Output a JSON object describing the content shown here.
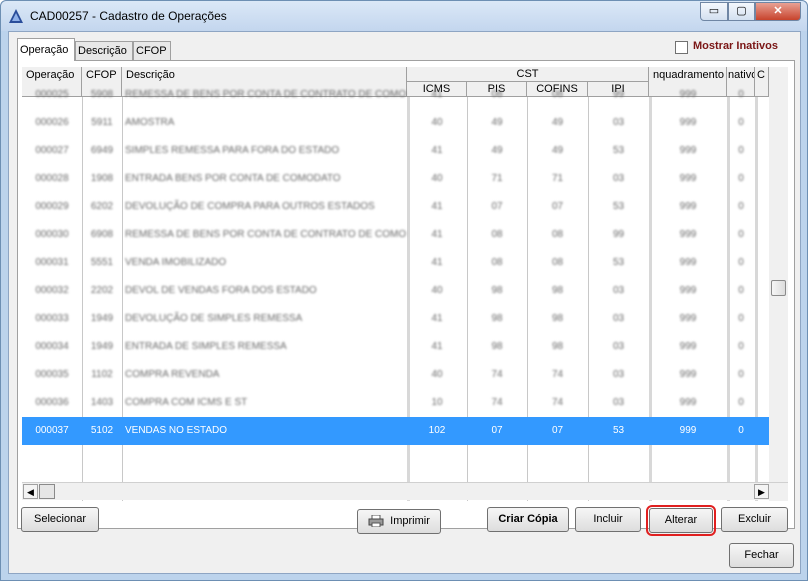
{
  "window": {
    "title": "CAD00257 - Cadastro de Operações",
    "min_symbol": "▭",
    "max_symbol": "▢",
    "close_symbol": "✕"
  },
  "tabs": [
    {
      "label": "Operação"
    },
    {
      "label": "Descrição"
    },
    {
      "label": "CFOP"
    }
  ],
  "filter": {
    "show_inactive_label": "Mostrar Inativos",
    "show_inactive_checked": false
  },
  "grid": {
    "headers": {
      "operacao": "Operação",
      "cfop": "CFOP",
      "descricao": "Descrição",
      "cst": "CST",
      "icms": "ICMS",
      "pis": "PIS",
      "cofins": "COFINS",
      "ipi": "IPI",
      "enquadramento": "nquadramento IF",
      "inativo": "nativo",
      "extra": "C"
    },
    "rows": [
      {
        "operacao": "000025",
        "cfop": "5908",
        "descricao": "REMESSA DE BENS POR CONTA DE CONTRATO DE COMODATO",
        "icms": "41",
        "pis": "08",
        "cofins": "08",
        "ipi": "99",
        "enquadramento": "999",
        "inativo": "0",
        "blurred": true
      },
      {
        "operacao": "000026",
        "cfop": "5911",
        "descricao": "AMOSTRA",
        "icms": "40",
        "pis": "49",
        "cofins": "49",
        "ipi": "03",
        "enquadramento": "999",
        "inativo": "0",
        "blurred": true
      },
      {
        "operacao": "000027",
        "cfop": "6949",
        "descricao": "SIMPLES REMESSA PARA FORA DO ESTADO",
        "icms": "41",
        "pis": "49",
        "cofins": "49",
        "ipi": "53",
        "enquadramento": "999",
        "inativo": "0",
        "blurred": true
      },
      {
        "operacao": "000028",
        "cfop": "1908",
        "descricao": "ENTRADA BENS POR CONTA DE COMODATO",
        "icms": "40",
        "pis": "71",
        "cofins": "71",
        "ipi": "03",
        "enquadramento": "999",
        "inativo": "0",
        "blurred": true
      },
      {
        "operacao": "000029",
        "cfop": "6202",
        "descricao": "DEVOLUÇÃO DE COMPRA PARA OUTROS ESTADOS",
        "icms": "41",
        "pis": "07",
        "cofins": "07",
        "ipi": "53",
        "enquadramento": "999",
        "inativo": "0",
        "blurred": true
      },
      {
        "operacao": "000030",
        "cfop": "6908",
        "descricao": "REMESSA DE BENS POR CONTA DE CONTRATO DE COMODATO",
        "icms": "41",
        "pis": "08",
        "cofins": "08",
        "ipi": "99",
        "enquadramento": "999",
        "inativo": "0",
        "blurred": true
      },
      {
        "operacao": "000031",
        "cfop": "5551",
        "descricao": "VENDA IMOBILIZADO",
        "icms": "41",
        "pis": "08",
        "cofins": "08",
        "ipi": "53",
        "enquadramento": "999",
        "inativo": "0",
        "blurred": true
      },
      {
        "operacao": "000032",
        "cfop": "2202",
        "descricao": "DEVOL DE VENDAS FORA DOS ESTADO",
        "icms": "40",
        "pis": "98",
        "cofins": "98",
        "ipi": "03",
        "enquadramento": "999",
        "inativo": "0",
        "blurred": true
      },
      {
        "operacao": "000033",
        "cfop": "1949",
        "descricao": "DEVOLUÇÃO DE SIMPLES REMESSA",
        "icms": "41",
        "pis": "98",
        "cofins": "98",
        "ipi": "03",
        "enquadramento": "999",
        "inativo": "0",
        "blurred": true
      },
      {
        "operacao": "000034",
        "cfop": "1949",
        "descricao": "ENTRADA DE SIMPLES REMESSA",
        "icms": "41",
        "pis": "98",
        "cofins": "98",
        "ipi": "03",
        "enquadramento": "999",
        "inativo": "0",
        "blurred": true
      },
      {
        "operacao": "000035",
        "cfop": "1102",
        "descricao": "COMPRA REVENDA",
        "icms": "40",
        "pis": "74",
        "cofins": "74",
        "ipi": "03",
        "enquadramento": "999",
        "inativo": "0",
        "blurred": true
      },
      {
        "operacao": "000036",
        "cfop": "1403",
        "descricao": "COMPRA COM ICMS E ST",
        "icms": "10",
        "pis": "74",
        "cofins": "74",
        "ipi": "03",
        "enquadramento": "999",
        "inativo": "0",
        "blurred": true
      },
      {
        "operacao": "000037",
        "cfop": "5102",
        "descricao": "VENDAS NO ESTADO",
        "icms": "102",
        "pis": "07",
        "cofins": "07",
        "ipi": "53",
        "enquadramento": "999",
        "inativo": "0",
        "blurred": false,
        "selected": true
      },
      {
        "operacao": "",
        "cfop": "",
        "descricao": "",
        "icms": "",
        "pis": "",
        "cofins": "",
        "ipi": "",
        "enquadramento": "",
        "inativo": "",
        "blurred": false
      }
    ]
  },
  "scrollbar": {
    "left_arrow": "◀",
    "right_arrow": "▶"
  },
  "buttons": {
    "selecionar": "Selecionar",
    "imprimir": "Imprimir",
    "criar_copia": "Criar Cópia",
    "incluir": "Incluir",
    "alterar": "Alterar",
    "excluir": "Excluir",
    "fechar": "Fechar"
  },
  "colors": {
    "selection": "#3399ff",
    "focus_outline": "#e02020",
    "inactive_label": "#7a1515"
  }
}
